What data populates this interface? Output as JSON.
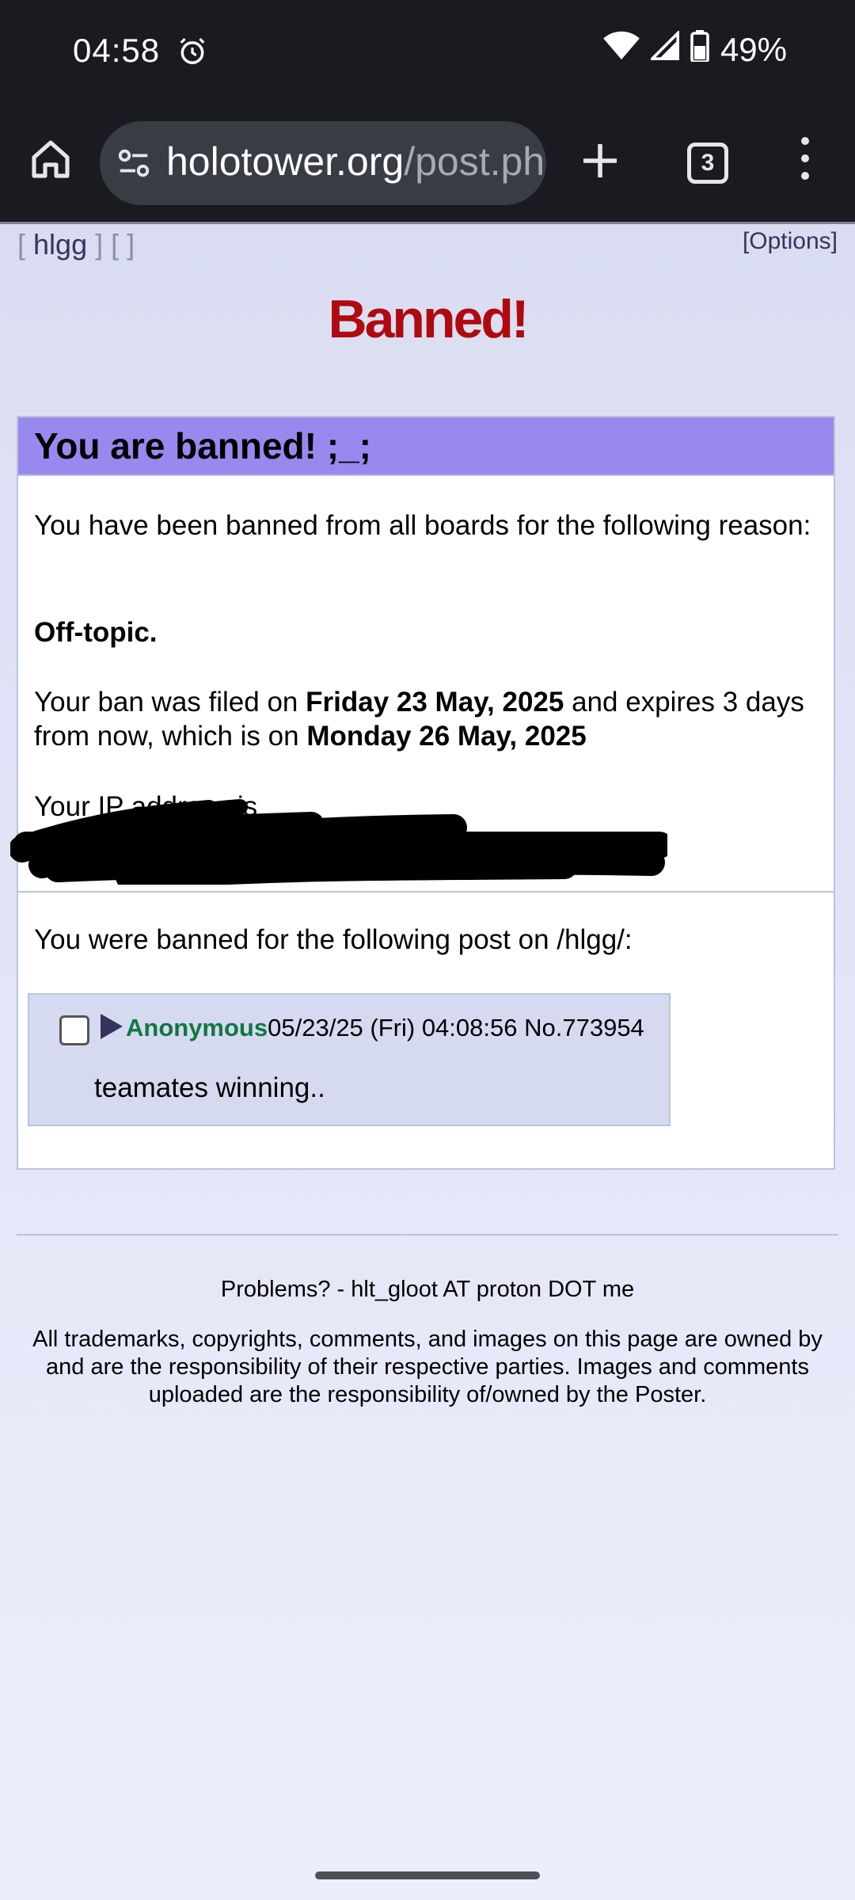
{
  "status_bar": {
    "time": "04:58",
    "battery": "49%",
    "icons": [
      "alarm-icon",
      "wifi-icon",
      "cell-signal-icon",
      "battery-icon"
    ]
  },
  "browser": {
    "url_host": "holotower.org",
    "url_path": "/post.ph",
    "tab_count": "3"
  },
  "board_nav": {
    "open_bracket": "[",
    "board": "hlgg",
    "close_bracket": "]",
    "empty_brackets": "[ ]",
    "options": "[Options]"
  },
  "page_title": "Banned!",
  "ban": {
    "heading": "You are banned! ;_;",
    "intro": "You have been banned from all boards for the following reason:",
    "reason": "Off-topic.",
    "filed_prefix": "Your ban was filed on ",
    "filed_date": "Friday 23 May, 2025",
    "filed_middle": " and expires 3 days from now, which is on ",
    "expires_date": "Monday 26 May, 2025",
    "ip_prefix": "Your IP address is",
    "post_intro": "You were banned for the following post on /hlgg/:"
  },
  "post": {
    "name": "Anonymous",
    "datetime": "05/23/25 (Fri) 04:08:56",
    "number": "No.773954",
    "body": "teamates winning.."
  },
  "footer": {
    "contact": "Problems? - hlt_gloot AT proton DOT me",
    "legal": "All trademarks, copyrights, comments, and images on this page are owned by and are the responsibility of their respective parties. Images and comments uploaded are the responsibility of/owned by the Poster."
  },
  "colors": {
    "title_red": "#af0a0f",
    "header_purple": "#9988ee",
    "name_green": "#117743",
    "post_bg": "#d6daf0"
  }
}
